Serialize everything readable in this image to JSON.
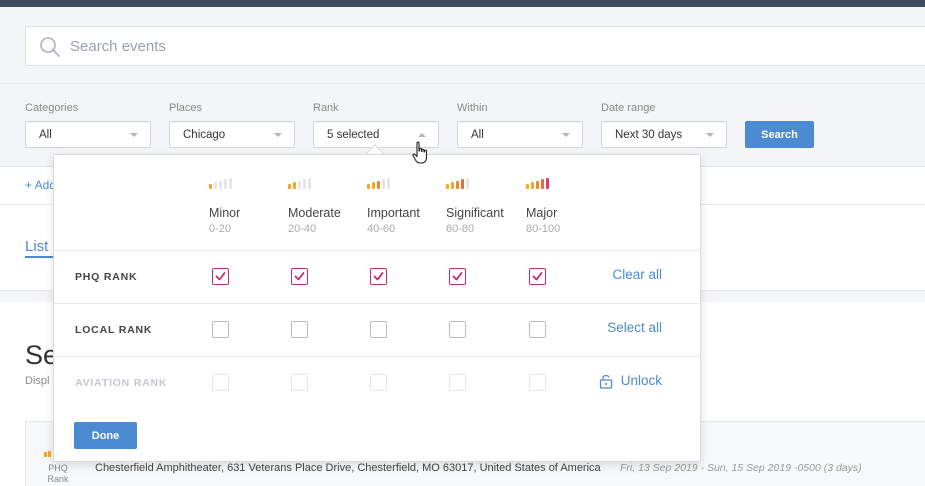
{
  "search": {
    "placeholder": "Search events"
  },
  "filters": {
    "categories": {
      "label": "Categories",
      "value": "All"
    },
    "places": {
      "label": "Places",
      "value": "Chicago"
    },
    "rank": {
      "label": "Rank",
      "value": "5 selected"
    },
    "within": {
      "label": "Within",
      "value": "All"
    },
    "date_range": {
      "label": "Date range",
      "value": "Next 30 days"
    },
    "search_button": "Search"
  },
  "background": {
    "add_link": "+ Add",
    "list_tab": "List",
    "title": "Se",
    "subtitle": "Displ",
    "result": {
      "rank_label": "PHQ Rank",
      "address": "Chesterfield Amphitheater, 631 Veterans Place Drive, Chesterfield, MO 63017, United States of America",
      "date": "Fri, 13 Sep 2019 - Sun, 15 Sep 2019 -0500 (3 days)"
    }
  },
  "rank_popover": {
    "levels": [
      {
        "name": "Minor",
        "range": "0-20",
        "active_bars": 1,
        "color": "#f5a623"
      },
      {
        "name": "Moderate",
        "range": "20-40",
        "active_bars": 2,
        "color": "#f5a623"
      },
      {
        "name": "Important",
        "range": "40-60",
        "active_bars": 3,
        "color": "#f08a24"
      },
      {
        "name": "Significant",
        "range": "60-80",
        "active_bars": 4,
        "color": "#ec6a3c"
      },
      {
        "name": "Major",
        "range": "80-100",
        "active_bars": 5,
        "color": "#e03c6a"
      }
    ],
    "rows": [
      {
        "label": "PHQ RANK",
        "checked": [
          true,
          true,
          true,
          true,
          true
        ],
        "action": "Clear all"
      },
      {
        "label": "LOCAL RANK",
        "checked": [
          false,
          false,
          false,
          false,
          false
        ],
        "action": "Select all"
      },
      {
        "label": "AVIATION RANK",
        "checked": [
          false,
          false,
          false,
          false,
          false
        ],
        "action": "Unlock",
        "disabled": true
      }
    ],
    "done_label": "Done"
  },
  "colors": {
    "accent": "#4c8ad1",
    "check": "#c82a66",
    "topbar": "#3b4a5e"
  },
  "icons": {
    "search": "search-icon",
    "lock": "lock-icon",
    "cursor": "hand-pointer-icon"
  }
}
